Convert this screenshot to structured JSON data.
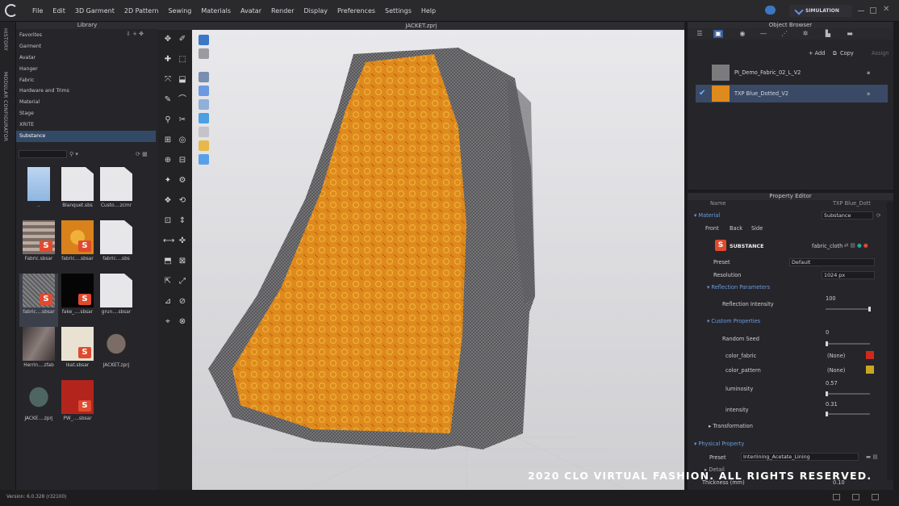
{
  "menubar": {
    "items": [
      "File",
      "Edit",
      "3D Garment",
      "2D Pattern",
      "Sewing",
      "Materials",
      "Avatar",
      "Render",
      "Display",
      "Preferences",
      "Settings",
      "Help"
    ],
    "mode": "SIMULATION"
  },
  "side_tabs": [
    "HISTORY",
    "MODULAR CONFIGURATOR"
  ],
  "library": {
    "title": "Library",
    "tree": [
      "Favorites",
      "Garment",
      "Avatar",
      "Hanger",
      "Fabric",
      "Hardware and Trims",
      "Material",
      "Stage",
      "XRITE",
      "Substance"
    ],
    "selected": "Substance",
    "items": [
      {
        "label": "..",
        "kind": "folder"
      },
      {
        "label": "Blanquet.sbs",
        "kind": "doc"
      },
      {
        "label": "Custo....zcmr",
        "kind": "doc"
      },
      {
        "label": "Fabric.sbsar",
        "kind": "plaid"
      },
      {
        "label": "fabric....sbsar",
        "kind": "orange"
      },
      {
        "label": "fabric....sbs",
        "kind": "doc"
      },
      {
        "label": "fabric....sbsar",
        "kind": "gray"
      },
      {
        "label": "fake_....sbsar",
        "kind": "black"
      },
      {
        "label": "grun....sbsar",
        "kind": "doc"
      },
      {
        "label": "Herrin....zfab",
        "kind": "drape"
      },
      {
        "label": "Ikat.sbsar",
        "kind": "cream"
      },
      {
        "label": "JACKET.zprj",
        "kind": "jacket"
      },
      {
        "label": "JACKE....zprj",
        "kind": "jacket2"
      },
      {
        "label": "PW_....sbsar",
        "kind": "red"
      }
    ]
  },
  "viewport": {
    "title": "JACKET.zprj"
  },
  "object_browser": {
    "title": "Object Browser",
    "add_label": "+ Add",
    "copy_label": "Copy",
    "assign_label": "Assign",
    "fabrics": [
      {
        "name": "PI_Demo_Fabric_02_L_V2",
        "selected": false
      },
      {
        "name": "TXP Blue_Dotted_V2",
        "selected": true
      }
    ]
  },
  "property_editor": {
    "title": "Property Editor",
    "name_label": "Name",
    "name_value": "TXP Blue_Dott",
    "material_label": "Material",
    "material_value": "Substance",
    "tabs": [
      "Front",
      "Back",
      "Side"
    ],
    "substance_logo": "SUBSTANCE",
    "substance_file": "fabric_cloth",
    "preset_label": "Preset",
    "preset_value": "Default",
    "resolution_label": "Resolution",
    "resolution_value": "1024 px",
    "reflection_section": "Reflection Parameters",
    "reflection_intensity_label": "Reflection Intensity",
    "reflection_intensity_value": "100",
    "custom_section": "Custom Properties",
    "random_seed_label": "Random Seed",
    "random_seed_value": "0",
    "color_fabric_label": "color_fabric",
    "color_fabric_value": "(None)",
    "color_pattern_label": "color_pattern",
    "color_pattern_value": "(None)",
    "luminosity_label": "luminosity",
    "luminosity_value": "0.57",
    "intensity_label": "intensity",
    "intensity_value": "0.31",
    "transformation_section": "Transformation",
    "physical_section": "Physical Property",
    "phys_preset_label": "Preset",
    "phys_preset_value": "Interlining_Acetate_Lining",
    "detail_label": "Detail",
    "thickness_label": "Thickness (mm)",
    "thickness_value": "0.10"
  },
  "colors": {
    "color_fabric": "#d0281e",
    "color_pattern": "#c9a820",
    "accent": "#3a5f9a"
  },
  "status": {
    "version": "Version: 6.0.328 (r32100)"
  },
  "watermark": "2020 CLO VIRTUAL FASHION. ALL RIGHTS RESERVED."
}
